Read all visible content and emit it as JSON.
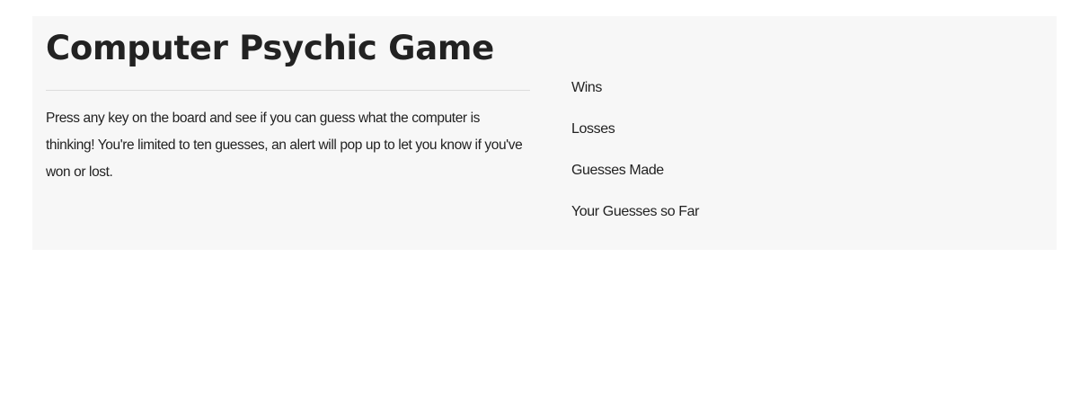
{
  "game": {
    "title": "Computer Psychic Game",
    "description": "Press any key on the board and see if you can guess what the computer is thinking! You're limited to ten guesses, an alert will pop up to let you know if you've won or lost."
  },
  "stats": {
    "wins_label": "Wins",
    "losses_label": "Losses",
    "guesses_made_label": "Guesses Made",
    "guesses_so_far_label": "Your Guesses so Far"
  },
  "colors": {
    "panel_background": "#f7f7f7",
    "text": "#222222",
    "divider": "#dcdcdc"
  }
}
